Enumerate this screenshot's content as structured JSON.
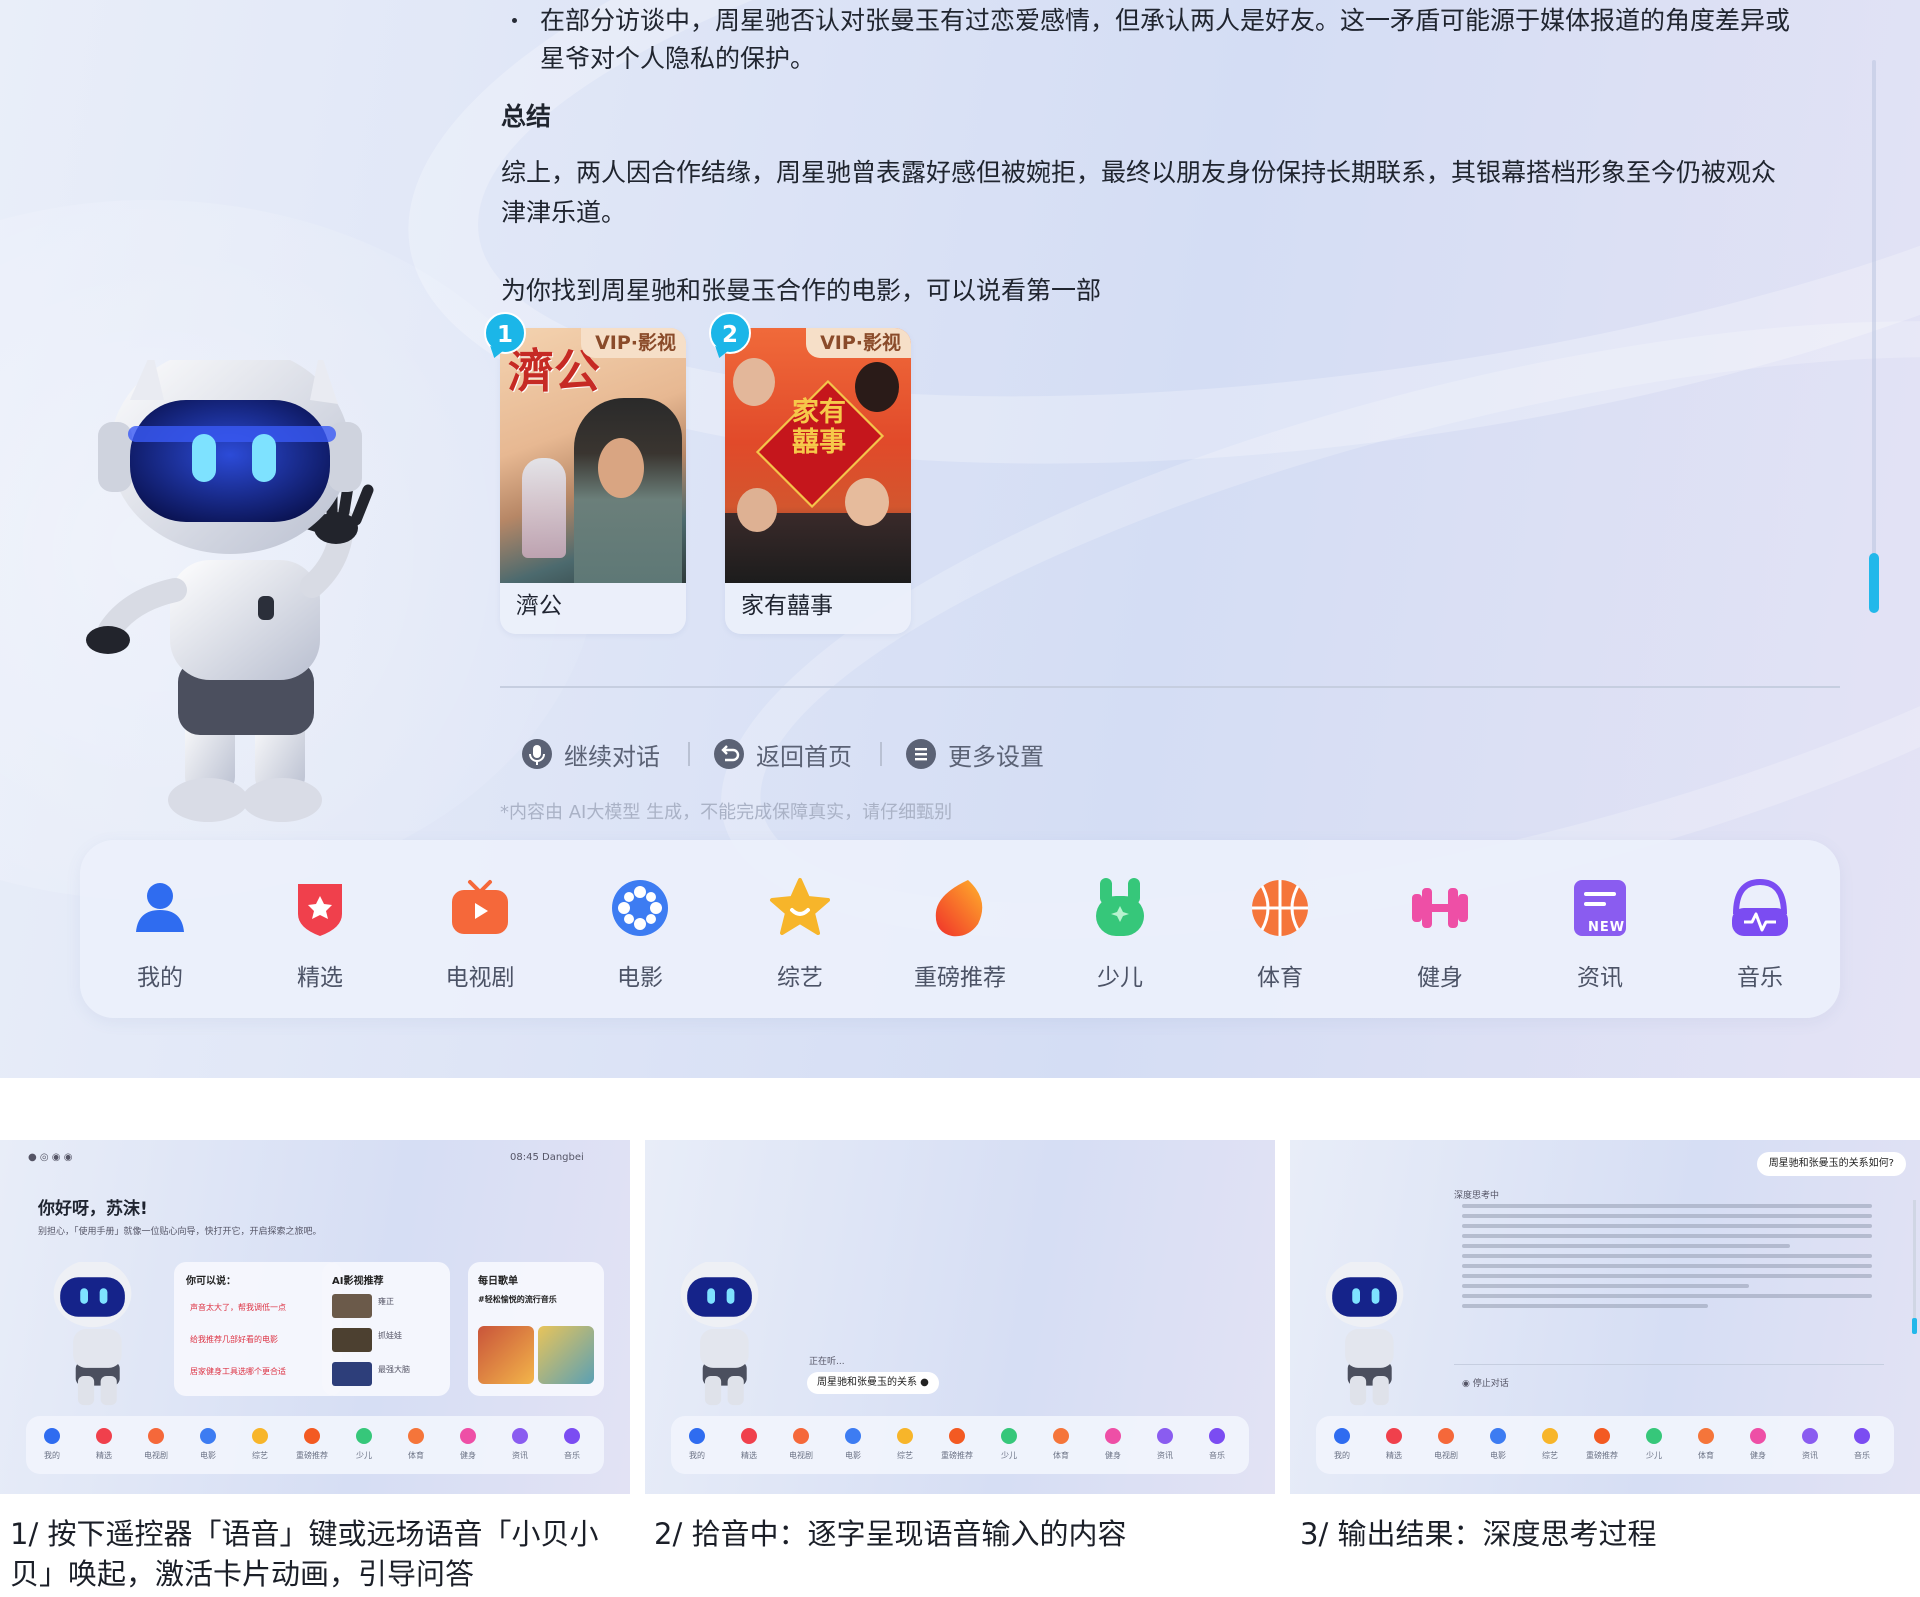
{
  "main": {
    "bullet_text_line1": "在部分访谈中，周星驰否认对张曼玉有过恋爱感情，但承认两人是好友。这一矛盾可能源于媒体报道的角度差异或",
    "bullet_text_line2": "星爷对个人隐私的保护。",
    "summary_heading": "总结",
    "summary_line1": "综上，两人因合作结缘，周星驰曾表露好感但被婉拒，最终以朋友身份保持长期联系，其银幕搭档形象至今仍被观众",
    "summary_line2": "津津乐道。",
    "prompt": "为你找到周星驰和张曼玉合作的电影，可以说看第一部",
    "movies": [
      {
        "index": "1",
        "badge": "VIP·影视",
        "title": "濟公",
        "poster_text": "濟公"
      },
      {
        "index": "2",
        "badge": "VIP·影视",
        "title": "家有囍事",
        "poster_text": "家有囍事"
      }
    ],
    "actions": [
      {
        "label": "继续对话",
        "icon": "microphone-icon"
      },
      {
        "label": "返回首页",
        "icon": "return-icon"
      },
      {
        "label": "更多设置",
        "icon": "menu-icon"
      }
    ],
    "disclaimer": "*内容由 AI大模型 生成，不能完成保障真实，请仔细甄别"
  },
  "nav": {
    "items": [
      {
        "label": "我的",
        "icon": "user-icon",
        "color": "#2f6cf0"
      },
      {
        "label": "精选",
        "icon": "badge-star-icon",
        "color": "#f0404c"
      },
      {
        "label": "电视剧",
        "icon": "tv-icon",
        "color": "#f5683a"
      },
      {
        "label": "电影",
        "icon": "film-reel-icon",
        "color": "#3d7cf2"
      },
      {
        "label": "综艺",
        "icon": "star-smile-icon",
        "color": "#f7b52a"
      },
      {
        "label": "重磅推荐",
        "icon": "flame-icon",
        "color": "#f35a22"
      },
      {
        "label": "少儿",
        "icon": "bunny-icon",
        "color": "#36c77a"
      },
      {
        "label": "体育",
        "icon": "basketball-icon",
        "color": "#f5753a"
      },
      {
        "label": "健身",
        "icon": "dumbbell-icon",
        "color": "#ee4fa6"
      },
      {
        "label": "资讯",
        "icon": "news-icon",
        "color": "#8a5cf0"
      },
      {
        "label": "音乐",
        "icon": "headphones-icon",
        "color": "#7b4cf2"
      }
    ],
    "news_badge": "NEW"
  },
  "thumb1": {
    "status_time": "08:45",
    "status_user": "Dangbei",
    "greeting": "你好呀，苏沫!",
    "sub": "别担心，「使用手册」就像一位贴心向导，快打开它，开启探索之旅吧。",
    "card1_title": "你可以说：",
    "card1_items": [
      "声音太大了，帮我调低一点",
      "给我推荐几部好看的电影",
      "居家健身工具选哪个更合适"
    ],
    "card2_title": "AI影视推荐",
    "card2_items": [
      "雍正",
      "抓娃娃",
      "最强大脑"
    ],
    "card3_title": "每日歌单",
    "card3_sub": "#轻松愉悦的流行音乐"
  },
  "thumb2": {
    "listening": "正在听...",
    "query": "周星驰和张曼玉的关系"
  },
  "thumb3": {
    "question": "周星驰和张曼玉的关系如何?",
    "thinking": "深度思考中",
    "stop": "停止对话"
  },
  "captions": {
    "c1_line1": "1/ 按下遥控器「语音」键或远场语音「小贝小",
    "c1_line2": "贝」唤起，激活卡片动画，引导问答",
    "c2": "2/ 拾音中：逐字呈现语音输入的内容",
    "c3": "3/ 输出结果：深度思考过程"
  }
}
